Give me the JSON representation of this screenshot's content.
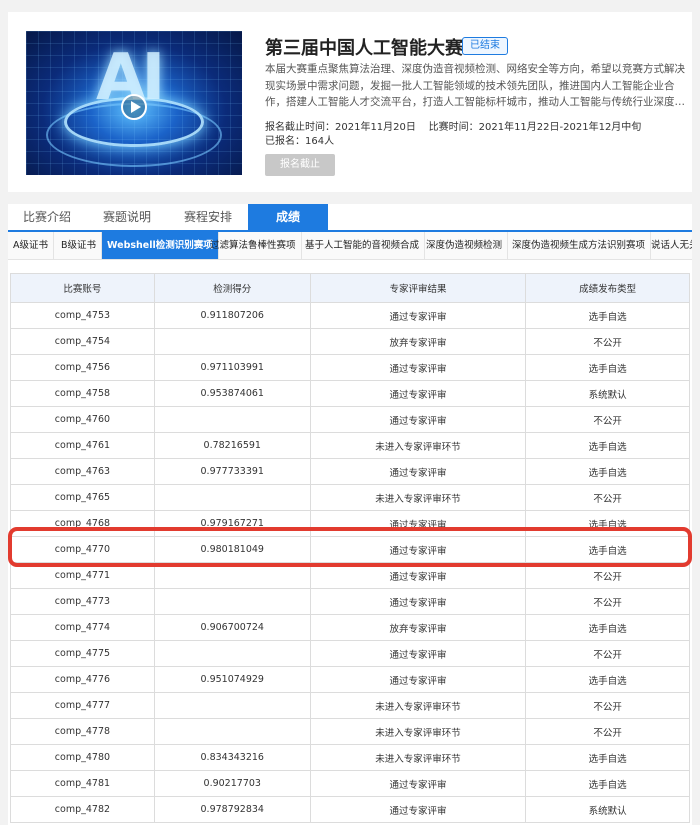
{
  "competition": {
    "title": "第三届中国人工智能大赛",
    "status": "已结束",
    "description": "本届大赛重点聚焦算法治理、深度伪造音视频检测、网络安全等方向，希望以竞赛方式解决现实场景中需求问题，发掘一批人工智能领域的技术领先团队，推进国内人工智能企业合作，搭建人工智能人才交流平台，打造人工智能标杆城市，推动人工智能与传统行业深度…",
    "deadline_label": "报名截止时间：",
    "deadline": "2021年11月20日",
    "period_label": "比赛时间：",
    "period": "2021年11月22日-2021年12月中旬",
    "registered_label": "已报名：",
    "registered": "164人",
    "register_button": "报名截止"
  },
  "main_tabs": [
    "比赛介绍",
    "赛题说明",
    "赛程安排",
    "成绩"
  ],
  "sub_tabs": [
    "A级证书",
    "B级证书",
    "Webshell检测识别赛项",
    "过滤算法鲁棒性赛项",
    "基于人工智能的音视频合成",
    "深度伪造视频检测",
    "深度伪造视频生成方法识别赛项",
    "说话人无关"
  ],
  "table": {
    "headers": [
      "比赛账号",
      "检测得分",
      "专家评审结果",
      "成绩发布类型"
    ],
    "rows": [
      [
        "comp_4753",
        "0.911807206",
        "通过专家评审",
        "选手自选"
      ],
      [
        "comp_4754",
        "",
        "放弃专家评审",
        "不公开"
      ],
      [
        "comp_4756",
        "0.971103991",
        "通过专家评审",
        "选手自选"
      ],
      [
        "comp_4758",
        "0.953874061",
        "通过专家评审",
        "系统默认"
      ],
      [
        "comp_4760",
        "",
        "通过专家评审",
        "不公开"
      ],
      [
        "comp_4761",
        "0.78216591",
        "未进入专家评审环节",
        "选手自选"
      ],
      [
        "comp_4763",
        "0.977733391",
        "通过专家评审",
        "选手自选"
      ],
      [
        "comp_4765",
        "",
        "未进入专家评审环节",
        "不公开"
      ],
      [
        "comp_4768",
        "0.979167271",
        "通过专家评审",
        "选手自选"
      ],
      [
        "comp_4770",
        "0.980181049",
        "通过专家评审",
        "选手自选"
      ],
      [
        "comp_4771",
        "",
        "通过专家评审",
        "不公开"
      ],
      [
        "comp_4773",
        "",
        "通过专家评审",
        "不公开"
      ],
      [
        "comp_4774",
        "0.906700724",
        "放弃专家评审",
        "选手自选"
      ],
      [
        "comp_4775",
        "",
        "通过专家评审",
        "不公开"
      ],
      [
        "comp_4776",
        "0.951074929",
        "通过专家评审",
        "选手自选"
      ],
      [
        "comp_4777",
        "",
        "未进入专家评审环节",
        "不公开"
      ],
      [
        "comp_4778",
        "",
        "未进入专家评审环节",
        "不公开"
      ],
      [
        "comp_4780",
        "0.834343216",
        "未进入专家评审环节",
        "选手自选"
      ],
      [
        "comp_4781",
        "0.90217703",
        "通过专家评审",
        "选手自选"
      ],
      [
        "comp_4782",
        "0.978792834",
        "通过专家评审",
        "系统默认"
      ]
    ]
  },
  "highlight_color": "#e23b2f",
  "accent_color": "#1e7be0"
}
